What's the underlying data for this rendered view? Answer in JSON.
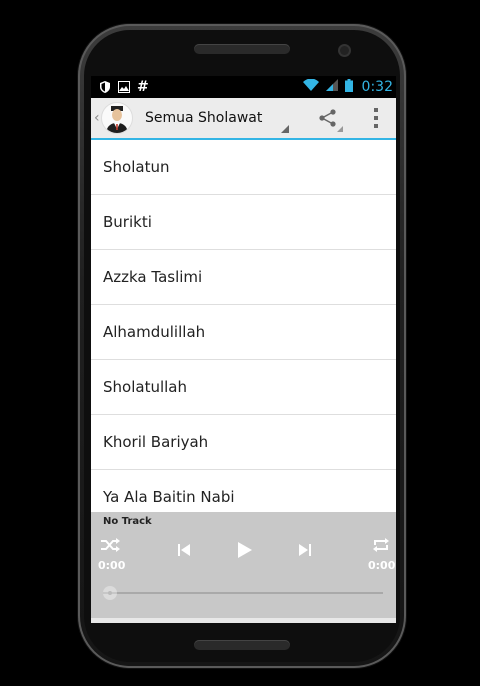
{
  "status_bar": {
    "left_icons": [
      "shield-icon",
      "image-icon",
      "hash-icon"
    ],
    "hash_glyph": "#",
    "right_icons": [
      "wifi-icon",
      "signal-icon",
      "battery-icon"
    ],
    "time": "0:32",
    "accent_color": "#33b5e5"
  },
  "action_bar": {
    "title": "Semua Sholawat",
    "avatar_icon": "user-avatar-icon",
    "share_icon": "share-icon",
    "overflow_icon": "overflow-menu-icon"
  },
  "songs": [
    "Sholatun",
    "Burikti",
    "Azzka Taslimi",
    "Alhamdulillah",
    "Sholatullah",
    "Khoril Bariyah",
    "Ya Ala Baitin Nabi"
  ],
  "player": {
    "track_title": "No Track",
    "elapsed": "0:00",
    "duration": "0:00",
    "progress": 0,
    "controls": [
      "shuffle-icon",
      "previous-icon",
      "play-icon",
      "next-icon",
      "repeat-icon"
    ]
  }
}
